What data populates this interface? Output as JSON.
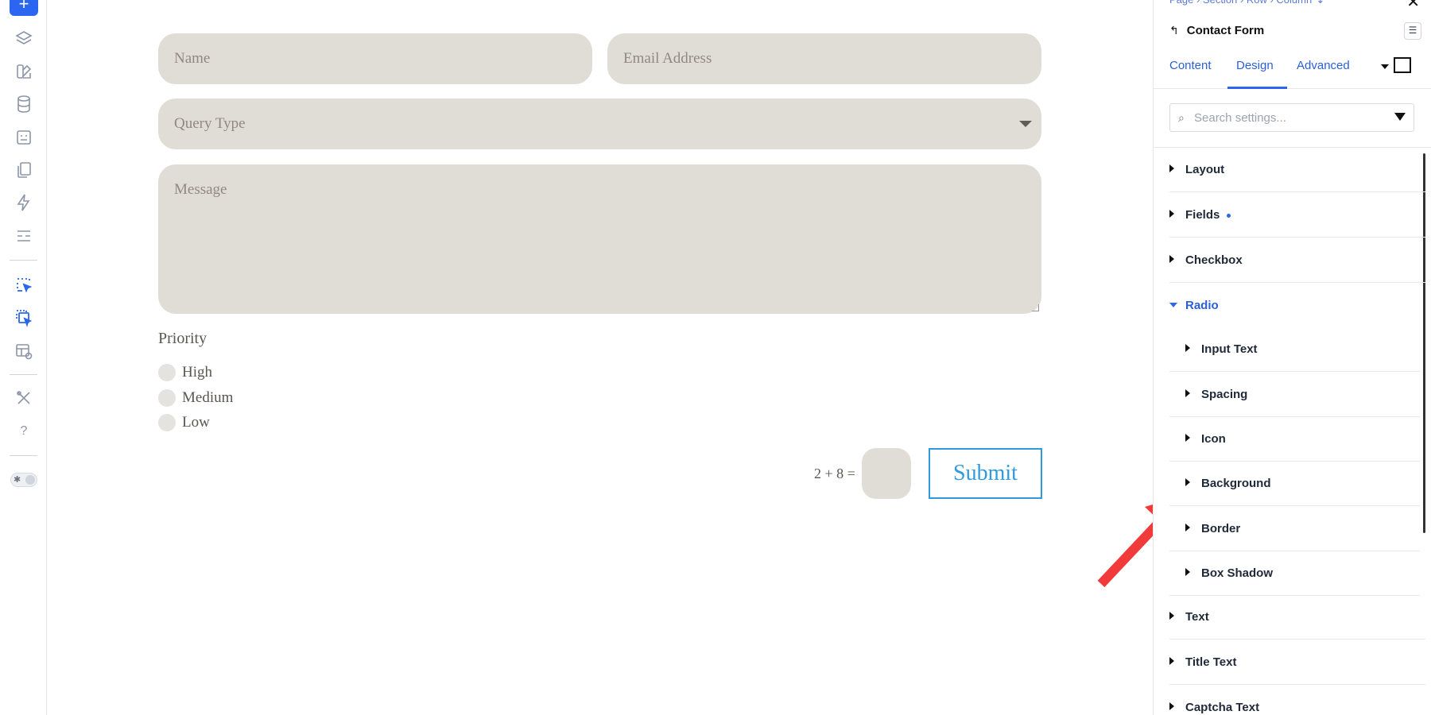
{
  "rail": {
    "add_label": "+"
  },
  "form": {
    "name_placeholder": "Name",
    "email_placeholder": "Email Address",
    "query_placeholder": "Query Type",
    "message_placeholder": "Message",
    "priority_label": "Priority",
    "priority_options": [
      "High",
      "Medium",
      "Low"
    ],
    "captcha_question": "2 + 8 =",
    "submit_label": "Submit"
  },
  "panel": {
    "breadcrumb": "Page › Section › Row › Column ↴",
    "close_label": "✕",
    "title": "Contact Form",
    "back_label": "↰",
    "options_label": "☰",
    "tabs": [
      "Content",
      "Design",
      "Advanced"
    ],
    "active_tab": "Design",
    "search_placeholder": "Search settings...",
    "sections": [
      {
        "label": "Layout"
      },
      {
        "label": "Fields"
      },
      {
        "label": "Checkbox"
      },
      {
        "label": "Radio"
      },
      {
        "label": "Text"
      },
      {
        "label": "Title Text"
      },
      {
        "label": "Captcha Text"
      }
    ],
    "radio_subsections": [
      {
        "label": "Input Text"
      },
      {
        "label": "Spacing"
      },
      {
        "label": "Icon"
      },
      {
        "label": "Background"
      },
      {
        "label": "Border"
      },
      {
        "label": "Box Shadow"
      }
    ]
  },
  "colors": {
    "accent": "#2b65f0",
    "field_bg": "#e0ddd6",
    "submit": "#2f9bdf",
    "annotation_arrow": "#f23a3a"
  },
  "icons": [
    "layers-icon",
    "blocks-icon",
    "database-icon",
    "form-icon",
    "pages-icon",
    "bolt-icon",
    "sections-icon",
    "cursor-select-icon",
    "cursor-multi-select-icon",
    "preview-icon",
    "tools-icon",
    "help-icon",
    "theme-toggle-icon",
    "search-icon",
    "filter-icon"
  ]
}
